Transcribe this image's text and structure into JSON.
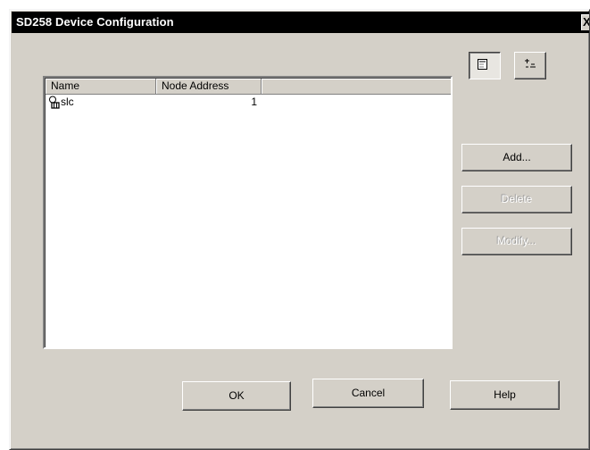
{
  "window": {
    "title": "SD258 Device Configuration",
    "close_glyph": "X"
  },
  "toolbar": {
    "list_view_icon": "list-view-icon",
    "sort_icon": "sort-icon"
  },
  "list": {
    "columns": [
      "Name",
      "Node Address",
      ""
    ],
    "rows": [
      {
        "icon": "device-node-icon",
        "name": "slc",
        "node_address": "1"
      }
    ]
  },
  "buttons": {
    "add": "Add...",
    "delete": "Delete",
    "modify": "Modify...",
    "ok": "OK",
    "cancel": "Cancel",
    "help": "Help"
  }
}
